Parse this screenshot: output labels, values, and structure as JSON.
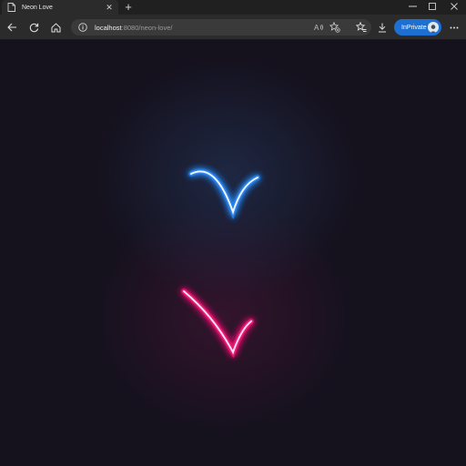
{
  "browser": {
    "tab": {
      "title": "Neon Love",
      "icon": "page-icon"
    },
    "address": {
      "host": "localhost",
      "path": ":8080/neon-love/"
    },
    "inprivate_label": "InPrivate",
    "icons": {
      "back": "back-arrow-icon",
      "refresh": "refresh-icon",
      "home": "home-icon",
      "site_info": "info-icon",
      "read_aloud": "read-aloud-icon",
      "add_favorite": "star-add-icon",
      "favorites": "favorites-icon",
      "downloads": "download-icon",
      "more": "more-dots-icon"
    }
  },
  "page": {
    "background_color": "#15111d",
    "strokes": [
      {
        "name": "blue-neon-stroke",
        "color": "#6ec3ff",
        "glow": "#2f8cff"
      },
      {
        "name": "pink-neon-stroke",
        "color": "#ff4fa3",
        "glow": "#ff1f7a"
      }
    ]
  }
}
